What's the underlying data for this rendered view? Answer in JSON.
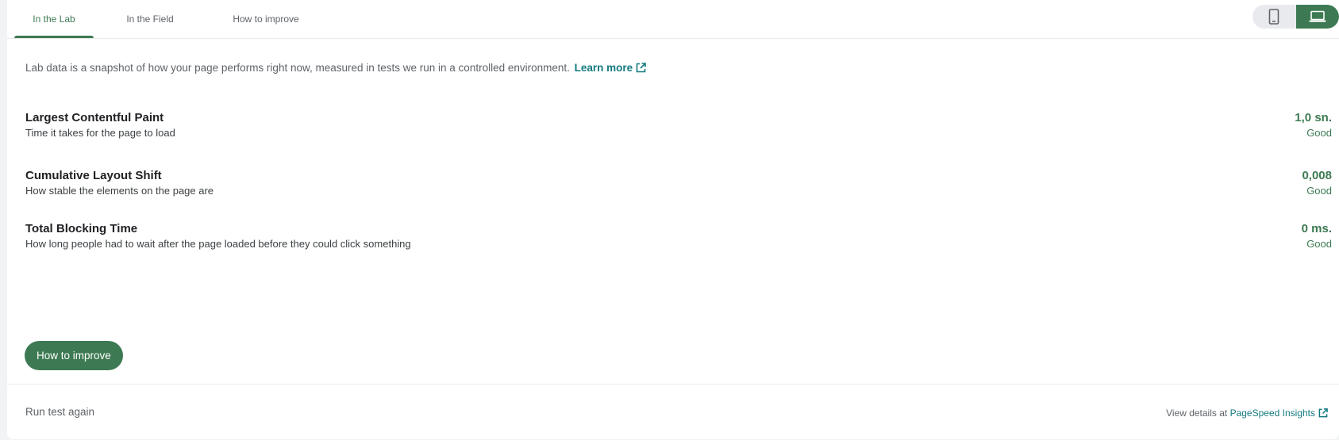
{
  "tabs": [
    {
      "label": "In the Lab",
      "active": true
    },
    {
      "label": "In the Field",
      "active": false
    },
    {
      "label": "How to improve",
      "active": false
    }
  ],
  "device_toggle": {
    "options": [
      {
        "icon": "mobile-phone-icon",
        "selected": false
      },
      {
        "icon": "laptop-icon",
        "selected": true
      }
    ]
  },
  "intro": {
    "text": "Lab data is a snapshot of how your page performs right now, measured in tests we run in a controlled environment.",
    "link_label": "Learn more",
    "link_icon": "external-link-icon"
  },
  "metrics": [
    {
      "name": "Largest Contentful Paint",
      "description": "Time it takes for the page to load",
      "value": "1,0 sn.",
      "rating": "Good"
    },
    {
      "name": "Cumulative Layout Shift",
      "description": "How stable the elements on the page are",
      "value": "0,008",
      "rating": "Good"
    },
    {
      "name": "Total Blocking Time",
      "description": "How long people had to wait after the page loaded before they could click something",
      "value": "0 ms.",
      "rating": "Good"
    }
  ],
  "actions": {
    "improve_button": "How to improve"
  },
  "footer": {
    "run_again": "Run test again",
    "view_details_prefix": "View details at",
    "view_details_link": "PageSpeed Insights",
    "link_icon": "external-link-icon"
  },
  "colors": {
    "accent_green": "#3d7a53",
    "link_teal": "#137a7f",
    "muted_text": "#5f6368"
  }
}
